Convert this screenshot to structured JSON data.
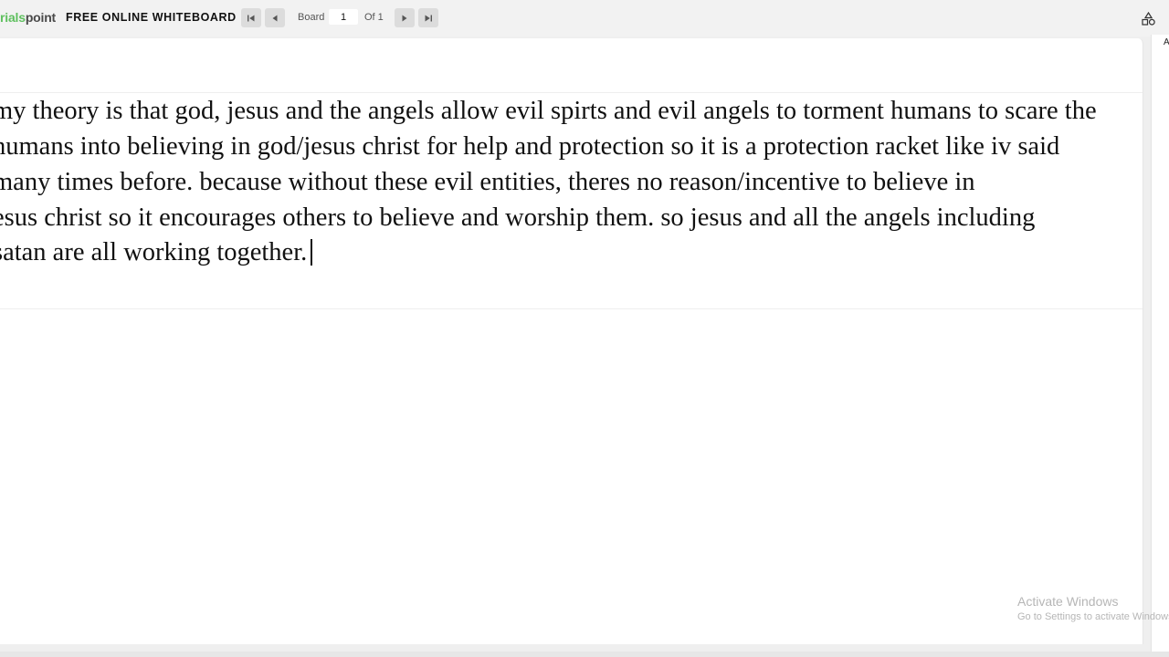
{
  "app": {
    "logo_green": "rials",
    "logo_dark": "point",
    "title": "FREE ONLINE WHITEBOARD"
  },
  "pager": {
    "board_label": "Board",
    "current_page": "1",
    "of_label": "Of 1"
  },
  "side_panel": {
    "tab_label": "A"
  },
  "whiteboard": {
    "text_lines": [
      "my theory is that god, jesus and the angels allow evil spirts and evil angels to torment humans to scare the",
      "humans into believing in god/jesus christ for help and protection so it is a protection racket like iv said",
      "many times before. because without these evil entities, theres no reason/incentive to believe in",
      "esus christ so it encourages others to believe and worship them. so jesus and all the angels including",
      "satan are all working together."
    ]
  },
  "watermark": {
    "title": "Activate Windows",
    "subtitle": "Go to Settings to activate Windows."
  },
  "icons": {
    "first": "first-page-icon",
    "prev": "previous-page-icon",
    "next": "next-page-icon",
    "last": "last-page-icon",
    "shapes": "shapes-icon"
  }
}
